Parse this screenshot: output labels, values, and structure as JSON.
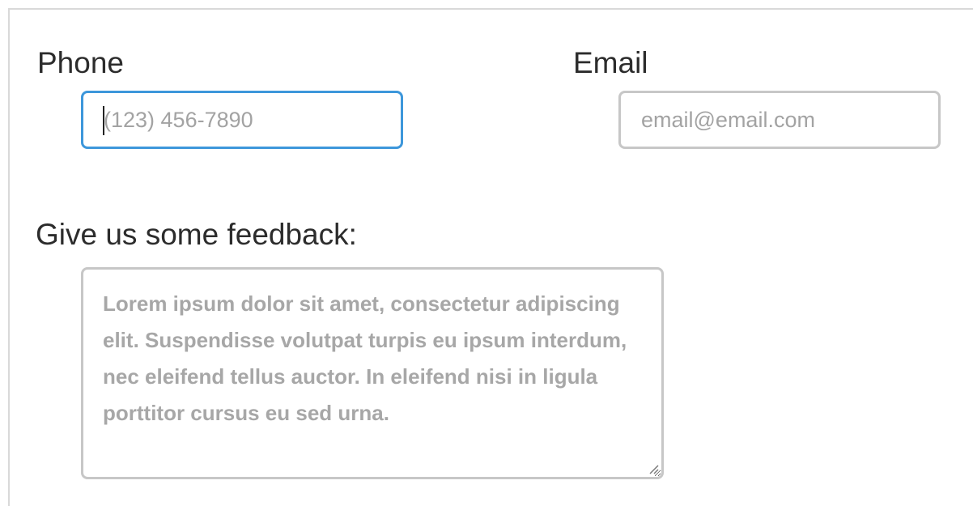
{
  "form": {
    "phone": {
      "label": "Phone",
      "placeholder": "(123) 456-7890",
      "value": ""
    },
    "email": {
      "label": "Email",
      "placeholder": "email@email.com",
      "value": ""
    },
    "feedback": {
      "label": "Give us some feedback:",
      "placeholder": "Lorem ipsum dolor sit amet, consectetur adipiscing elit. Suspendisse volutpat turpis eu ipsum interdum, nec eleifend tellus auctor. In eleifend nisi in ligula porttitor cursus eu sed urna.",
      "value": ""
    }
  },
  "colors": {
    "focus_border": "#3d97db",
    "default_border": "#c7c7c7",
    "label_text": "#2c2c2c",
    "placeholder_text": "#a3a3a3"
  }
}
